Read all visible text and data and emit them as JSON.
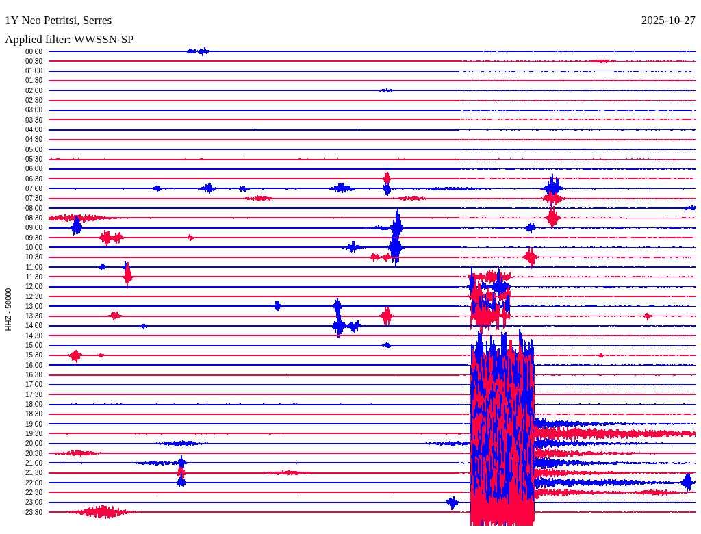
{
  "station": {
    "title": "1Y Neo Petritsi, Serres",
    "date": "2025-10-27",
    "filter": "Applied filter: WWSSN-SP"
  },
  "helicorder": {
    "axis_label": "HHZ - 50000",
    "rows": [
      {
        "time": "00:00",
        "color": "#0000ff"
      },
      {
        "time": "00:30",
        "color": "#ff0040"
      },
      {
        "time": "01:00",
        "color": "#0000ff"
      },
      {
        "time": "01:30",
        "color": "#ff0040"
      },
      {
        "time": "02:00",
        "color": "#0000ff"
      },
      {
        "time": "02:30",
        "color": "#ff0040"
      },
      {
        "time": "03:00",
        "color": "#0000ff"
      },
      {
        "time": "03:30",
        "color": "#ff0040"
      },
      {
        "time": "04:00",
        "color": "#0000ff"
      },
      {
        "time": "04:30",
        "color": "#ff0040"
      },
      {
        "time": "05:00",
        "color": "#0000ff"
      },
      {
        "time": "05:30",
        "color": "#ff0040"
      },
      {
        "time": "06:00",
        "color": "#0000ff"
      },
      {
        "time": "06:30",
        "color": "#ff0040"
      },
      {
        "time": "07:00",
        "color": "#0000ff"
      },
      {
        "time": "07:30",
        "color": "#ff0040"
      },
      {
        "time": "08:00",
        "color": "#0000ff"
      },
      {
        "time": "08:30",
        "color": "#ff0040"
      },
      {
        "time": "09:00",
        "color": "#0000ff"
      },
      {
        "time": "09:30",
        "color": "#ff0040"
      },
      {
        "time": "10:00",
        "color": "#0000ff"
      },
      {
        "time": "10:30",
        "color": "#ff0040"
      },
      {
        "time": "11:00",
        "color": "#0000ff"
      },
      {
        "time": "11:30",
        "color": "#ff0040"
      },
      {
        "time": "12:00",
        "color": "#0000ff"
      },
      {
        "time": "12:30",
        "color": "#ff0040"
      },
      {
        "time": "13:00",
        "color": "#0000ff"
      },
      {
        "time": "13:30",
        "color": "#ff0040"
      },
      {
        "time": "14:00",
        "color": "#0000ff"
      },
      {
        "time": "14:30",
        "color": "#ff0040"
      },
      {
        "time": "15:00",
        "color": "#0000ff"
      },
      {
        "time": "15:30",
        "color": "#ff0040"
      },
      {
        "time": "16:00",
        "color": "#0000ff"
      },
      {
        "time": "16:30",
        "color": "#ff0040"
      },
      {
        "time": "17:00",
        "color": "#0000ff"
      },
      {
        "time": "17:30",
        "color": "#ff0040"
      },
      {
        "time": "18:00",
        "color": "#0000ff"
      },
      {
        "time": "18:30",
        "color": "#ff0040"
      },
      {
        "time": "19:00",
        "color": "#0000ff"
      },
      {
        "time": "19:30",
        "color": "#ff0040"
      },
      {
        "time": "20:00",
        "color": "#0000ff"
      },
      {
        "time": "20:30",
        "color": "#ff0040"
      },
      {
        "time": "21:00",
        "color": "#0000ff"
      },
      {
        "time": "21:30",
        "color": "#ff0040"
      },
      {
        "time": "22:00",
        "color": "#0000ff"
      },
      {
        "time": "22:30",
        "color": "#ff0040"
      },
      {
        "time": "23:00",
        "color": "#0000ff"
      },
      {
        "time": "23:30",
        "color": "#ff0040"
      }
    ]
  }
}
